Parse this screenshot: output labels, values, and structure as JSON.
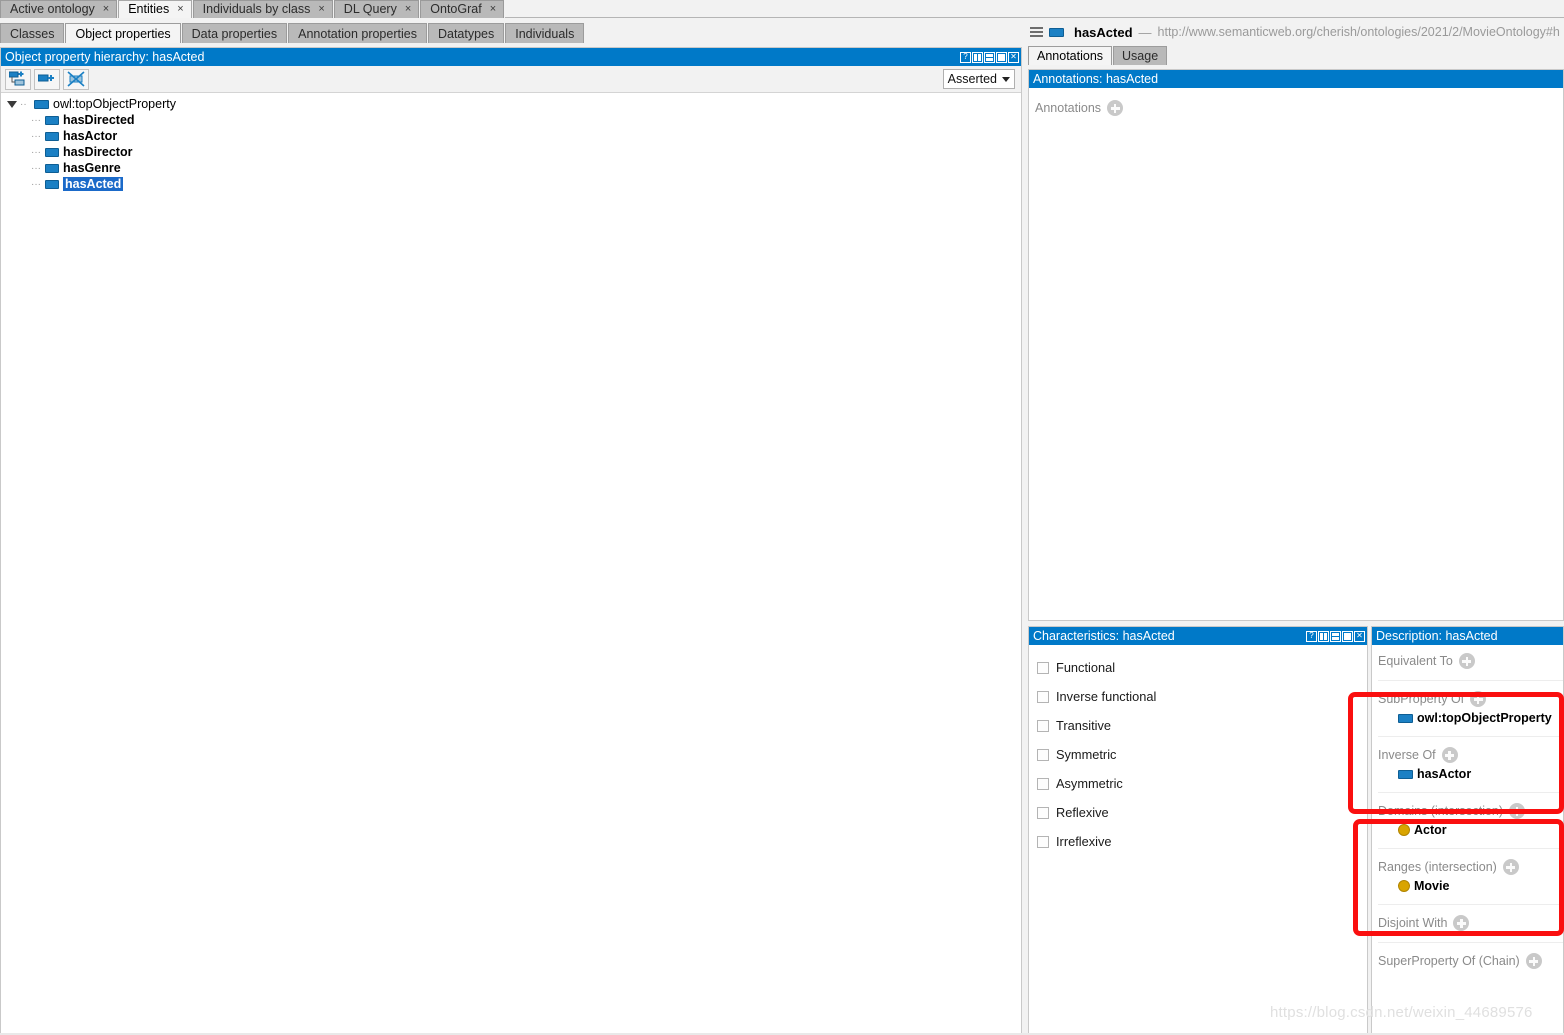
{
  "app_tabs": [
    {
      "label": "Active ontology",
      "active": false,
      "close": "×"
    },
    {
      "label": "Entities",
      "active": true,
      "close": "×"
    },
    {
      "label": "Individuals by class",
      "active": false,
      "close": "×"
    },
    {
      "label": "DL Query",
      "active": false,
      "close": "×"
    },
    {
      "label": "OntoGraf",
      "active": false,
      "close": "×"
    }
  ],
  "entity_tabs": [
    {
      "label": "Classes",
      "active": false
    },
    {
      "label": "Object properties",
      "active": true
    },
    {
      "label": "Data properties",
      "active": false
    },
    {
      "label": "Annotation properties",
      "active": false
    },
    {
      "label": "Datatypes",
      "active": false
    },
    {
      "label": "Individuals",
      "active": false
    }
  ],
  "hierarchy_panel": {
    "title": "Object property hierarchy: hasActed",
    "toolbar": {
      "add_sibling_label": "add-sub-property-icon",
      "add_child_label": "add-sibling-property-icon",
      "delete_label": "delete-property-icon"
    },
    "reasoner_selector": {
      "value": "Asserted",
      "caret": "▾"
    },
    "tree": {
      "root": {
        "label": "owl:topObjectProperty",
        "bold": false,
        "selected": false
      },
      "children": [
        {
          "label": "hasDirected",
          "selected": false
        },
        {
          "label": "hasActor",
          "selected": false
        },
        {
          "label": "hasDirector",
          "selected": false
        },
        {
          "label": "hasGenre",
          "selected": false
        },
        {
          "label": "hasActed",
          "selected": true
        }
      ]
    }
  },
  "entity_header": {
    "name": "hasActed",
    "dash": "—",
    "uri": "http://www.semanticweb.org/cherish/ontologies/2021/2/MovieOntology#h"
  },
  "sub_tabs": [
    {
      "label": "Annotations",
      "active": true
    },
    {
      "label": "Usage",
      "active": false
    }
  ],
  "annotations_panel": {
    "title": "Annotations: hasActed",
    "field_label": "Annotations"
  },
  "characteristics_panel": {
    "title": "Characteristics: hasActed",
    "items": [
      {
        "label": "Functional",
        "checked": false
      },
      {
        "label": "Inverse functional",
        "checked": false
      },
      {
        "label": "Transitive",
        "checked": false
      },
      {
        "label": "Symmetric",
        "checked": false
      },
      {
        "label": "Asymmetric",
        "checked": false
      },
      {
        "label": "Reflexive",
        "checked": false
      },
      {
        "label": "Irreflexive",
        "checked": false
      }
    ]
  },
  "description_panel": {
    "title": "Description: hasActed",
    "groups": [
      {
        "label": "Equivalent To",
        "values": []
      },
      {
        "label": "SubProperty Of",
        "values": [
          {
            "text": "owl:topObjectProperty",
            "icon": "object-property-icon"
          }
        ]
      },
      {
        "label": "Inverse Of",
        "values": [
          {
            "text": "hasActor",
            "icon": "object-property-icon"
          }
        ]
      },
      {
        "label": "Domains (intersection)",
        "values": [
          {
            "text": "Actor",
            "icon": "class-icon"
          }
        ]
      },
      {
        "label": "Ranges (intersection)",
        "values": [
          {
            "text": "Movie",
            "icon": "class-icon"
          }
        ]
      },
      {
        "label": "Disjoint With",
        "values": []
      },
      {
        "label": "SuperProperty Of (Chain)",
        "values": []
      }
    ]
  },
  "watermark": {
    "text": "https://blog.csdn.net/weixin_44689576"
  },
  "colors": {
    "panel_title_blue": "#0079c8",
    "selection_blue": "#1b6ac9",
    "property_icon_blue": "#1b80c4",
    "class_icon_yellow": "#d9a400",
    "highlight_red": "#fa0f0f",
    "tab_inactive_gray": "#b9b9b9",
    "tab_active_gray": "#f4f4f4"
  }
}
